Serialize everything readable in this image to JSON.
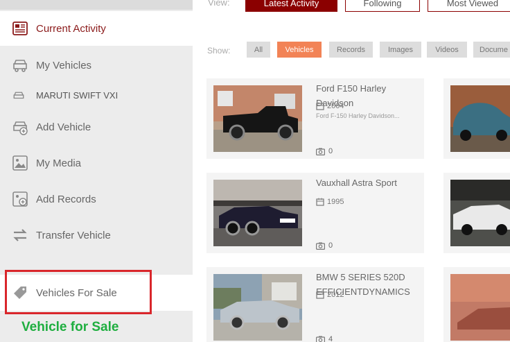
{
  "sidebar": {
    "items": [
      {
        "label": "Current Activity",
        "icon": "newspaper-icon"
      },
      {
        "label": "My Vehicles",
        "icon": "vehicles-icon"
      },
      {
        "label": "MARUTI SWIFT VXI",
        "icon": "car-icon"
      },
      {
        "label": "Add Vehicle",
        "icon": "add-vehicle-icon"
      },
      {
        "label": "My Media",
        "icon": "image-icon"
      },
      {
        "label": "Add Records",
        "icon": "add-record-icon"
      },
      {
        "label": "Transfer Vehicle",
        "icon": "transfer-arrows-icon"
      },
      {
        "label": "Vehicles For Sale",
        "icon": "tag-icon"
      }
    ],
    "annotation": "Vehicle for Sale"
  },
  "view": {
    "label": "View:",
    "buttons": [
      "Latest Activity",
      "Following",
      "Most Viewed"
    ],
    "active": "Latest Activity"
  },
  "show": {
    "label": "Show:",
    "filters": [
      "All",
      "Vehicles",
      "Records",
      "Images",
      "Videos",
      "Docume"
    ],
    "active": "Vehicles"
  },
  "cards": [
    {
      "title": "Ford F150 Harley Davidson",
      "year": "2004",
      "subtitle": "Ford F-150 Harley Davidson...",
      "count": "0"
    },
    {
      "title": "Vauxhall Astra Sport",
      "year": "1995",
      "subtitle": "",
      "count": "0"
    },
    {
      "title": "BMW 5 SERIES 520D EFFICIENTDYNAMICS",
      "year": "2012",
      "subtitle": "",
      "count": "4"
    }
  ],
  "colors": {
    "active_maroon": "#8b0000",
    "filter_active": "#f28356",
    "highlight_red": "#d9262b",
    "annotation_green": "#1eae3f"
  }
}
